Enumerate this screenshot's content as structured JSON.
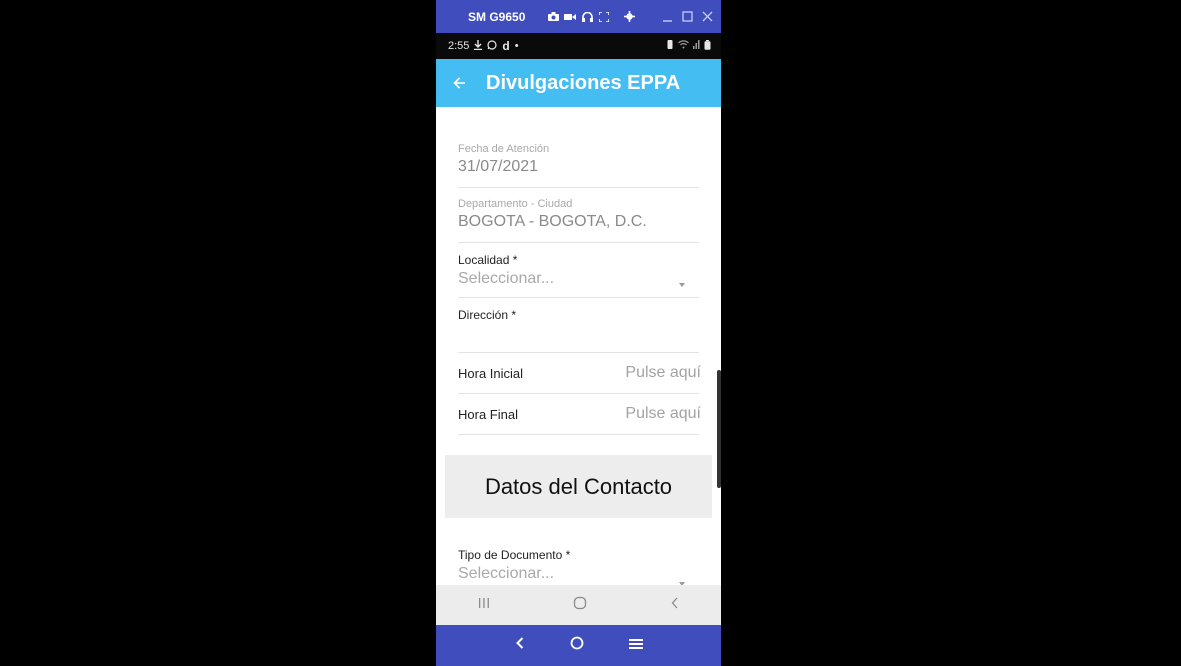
{
  "window": {
    "title": "SM G9650",
    "toolbar_icons": [
      "camera-icon",
      "video-icon",
      "headphones-icon",
      "fullscreen-icon",
      "settings-icon"
    ],
    "controls": [
      "minimize-icon",
      "maximize-icon",
      "close-icon"
    ]
  },
  "status_bar": {
    "time": "2:55",
    "left_icons": [
      "download-icon",
      "whatsapp-icon",
      "d",
      "•"
    ],
    "right_icons": [
      "vibrate-icon",
      "wifi-icon",
      "signal-icon",
      "battery-icon"
    ]
  },
  "app_bar": {
    "title": "Divulgaciones EPPA",
    "color": "#44bdf2"
  },
  "form": {
    "fecha": {
      "label": "Fecha de Atención",
      "value": "31/07/2021"
    },
    "departamento": {
      "label": "Departamento - Ciudad",
      "value": "BOGOTA - BOGOTA, D.C."
    },
    "localidad": {
      "label": "Localidad *",
      "placeholder": "Seleccionar..."
    },
    "direccion": {
      "label": "Dirección *",
      "value": ""
    },
    "hora_inicial": {
      "label": "Hora Inicial",
      "value": "Pulse aquí"
    },
    "hora_final": {
      "label": "Hora Final",
      "value": "Pulse aquí"
    },
    "section_title": "Datos del Contacto",
    "tipo_documento": {
      "label": "Tipo de Documento *",
      "placeholder": "Seleccionar..."
    }
  },
  "android_nav": [
    "recents-icon",
    "home-icon",
    "back-icon"
  ],
  "bottom_bar": {
    "icons": [
      "back-chevron-icon",
      "home-circle-icon",
      "menu-icon"
    ],
    "color": "#3f4dbd"
  }
}
